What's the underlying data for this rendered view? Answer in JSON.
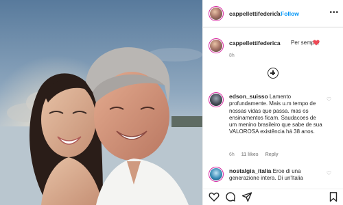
{
  "header": {
    "username": "cappellettifederica",
    "separator": "•",
    "follow_label": "Follow",
    "more_icon": "more-icon"
  },
  "caption": {
    "username": "cappellettifederica",
    "text": "Per sempre",
    "emoji": "red-heart",
    "time": "8h"
  },
  "load_more_icon": "plus-circle-icon",
  "comments": [
    {
      "username": "edson_suisso",
      "text": "Lamento profundamente. Mais u.m tempo de nossas vidas que passa. mas os ensinamentos ficam. Saudacoes de um menino brasileiro que sabe de sua VALOROSA existência há 38 anos.",
      "time": "6h",
      "likes": "11 likes",
      "reply": "Reply"
    },
    {
      "username": "nostalgia_italia",
      "text": "Eroe di una generazione intera. Di un'Italia"
    }
  ],
  "actions": [
    "heart-icon",
    "comment-icon",
    "share-icon",
    "bookmark-icon"
  ],
  "colors": {
    "accent": "#0095f6",
    "heart": "#ed4956",
    "text": "#262626",
    "muted": "#8e8e8e"
  }
}
